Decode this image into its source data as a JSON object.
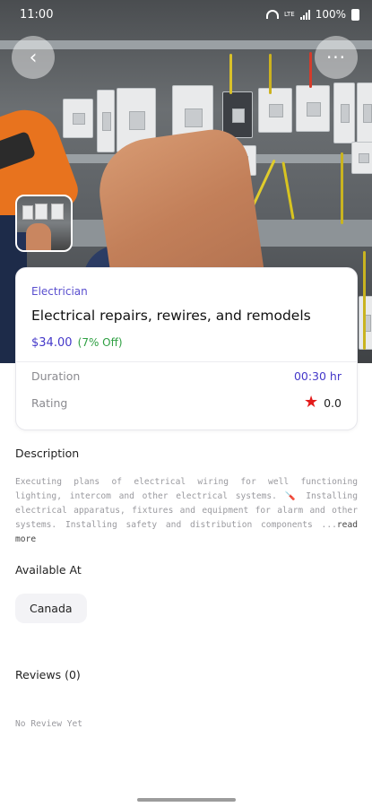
{
  "status_bar": {
    "time": "11:00",
    "network": "LTE",
    "battery": "100%"
  },
  "hero": {
    "back_icon": "chevron-left-icon",
    "more_icon": "more-horizontal-icon",
    "back_glyph": "‹",
    "more_glyph": "···"
  },
  "service": {
    "category": "Electrician",
    "title": "Electrical repairs, rewires, and remodels",
    "price": "$34.00",
    "discount": "(7% Off)",
    "duration_label": "Duration",
    "duration_value": "00:30 hr",
    "rating_label": "Rating",
    "rating_value": "0.0",
    "star_glyph": "★"
  },
  "description": {
    "title": "Description",
    "text": "Executing plans of electrical wiring for well functioning lighting, intercom and other electrical systems. 🪛 Installing electrical apparatus, fixtures and equipment for alarm and other systems. Installing safety and distribution components ...",
    "read_more": "read more"
  },
  "available": {
    "title": "Available At",
    "locations": [
      "Canada"
    ]
  },
  "reviews": {
    "title": "Reviews (0)",
    "empty_text": "No Review Yet"
  },
  "colors": {
    "accent": "#4438c9",
    "discount": "#2fa043",
    "star": "#e31b1b"
  }
}
